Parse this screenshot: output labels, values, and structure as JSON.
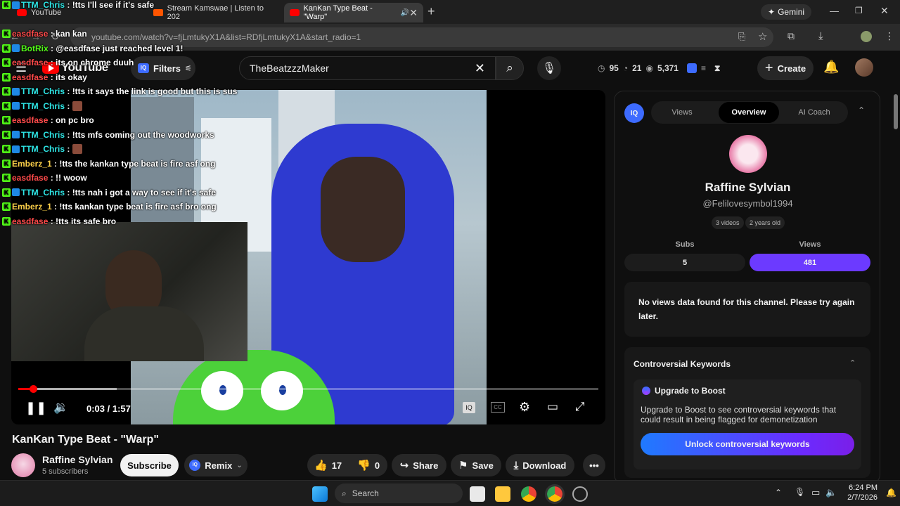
{
  "browser": {
    "tabs": [
      {
        "label": "YouTube"
      },
      {
        "label": "Stream Kamswae | Listen to 202"
      },
      {
        "label": "KanKan Type Beat - \"Warp\""
      }
    ],
    "profile": "Gemini",
    "url": "youtube.com/watch?v=fjLmtukyX1A&list=RDfjLmtukyX1A&start_radio=1"
  },
  "header": {
    "logo": "YouTube",
    "filters_label": "Filters",
    "search_value": "TheBeatzzzMaker",
    "stats": {
      "a": "95",
      "b": "21",
      "c": "5,371"
    },
    "create_label": "Create"
  },
  "chat": [
    {
      "user": "TTM_Chris",
      "text": "!tts I'll see if it's safe",
      "color": "#2ee6e6"
    },
    {
      "user": "",
      "text": "",
      "color": "#ffffff"
    },
    {
      "user": "easdfase",
      "text": "kan kan",
      "color": "#ff4a4a"
    },
    {
      "user": "BotRix",
      "text": "@easdfase just reached level 1!",
      "color": "#53fc18"
    },
    {
      "user": "easdfase",
      "text": "its on chrome duuh",
      "color": "#ff4a4a"
    },
    {
      "user": "easdfase",
      "text": "its okay",
      "color": "#ff4a4a"
    },
    {
      "user": "TTM_Chris",
      "text": "!tts it says the link is good but this is sus",
      "color": "#2ee6e6"
    },
    {
      "user": "TTM_Chris",
      "text": "",
      "color": "#2ee6e6"
    },
    {
      "user": "easdfase",
      "text": "on pc bro",
      "color": "#ff4a4a"
    },
    {
      "user": "TTM_Chris",
      "text": "!tts mfs coming out the woodworks",
      "color": "#2ee6e6"
    },
    {
      "user": "TTM_Chris",
      "text": "",
      "color": "#2ee6e6"
    },
    {
      "user": "Emberz_1",
      "text": "!tts the kankan type beat is fire asf ong",
      "color": "#ffd24a"
    },
    {
      "user": "easdfase",
      "text": "!! woow",
      "color": "#ff4a4a"
    },
    {
      "user": "TTM_Chris",
      "text": "!tts nah i got a way to see if it's safe",
      "color": "#2ee6e6"
    },
    {
      "user": "Emberz_1",
      "text": "!tts kankan type beat is fire asf bro ong",
      "color": "#ffd24a"
    },
    {
      "user": "easdfase",
      "text": "!tts its safe bro",
      "color": "#ff4a4a"
    }
  ],
  "player": {
    "time": "0:03 / 1:57",
    "progress": 0.026,
    "buffered": 0.17
  },
  "video": {
    "title": "KanKan Type Beat - \"Warp\"",
    "channel": "Raffine Sylvian",
    "subscribers": "5 subscribers",
    "subscribe_label": "Subscribe",
    "remix_label": "Remix",
    "likes": "17",
    "dislikes": "0",
    "share_label": "Share",
    "save_label": "Save",
    "download_label": "Download"
  },
  "panel": {
    "tabs": [
      "Views",
      "Overview",
      "AI Coach"
    ],
    "active_tab": "Overview",
    "channel_name": "Raffine Sylvian",
    "handle": "@Felilovesymbol1994",
    "videos": "3 videos",
    "age": "2 years old",
    "subs_label": "Subs",
    "subs_value": "5",
    "views_label": "Views",
    "views_value": "481",
    "no_data": "No views data found for this channel. Please try again later.",
    "controversial_title": "Controversial Keywords",
    "upgrade_title": "Upgrade to Boost",
    "upgrade_text": "Upgrade to Boost to see controversial keywords that could result in being flagged for demonetization",
    "unlock_label": "Unlock controversial keywords",
    "accent": "#6c3aff"
  },
  "taskbar": {
    "search_placeholder": "Search",
    "time": "6:24 PM",
    "date": "2/7/2026"
  }
}
